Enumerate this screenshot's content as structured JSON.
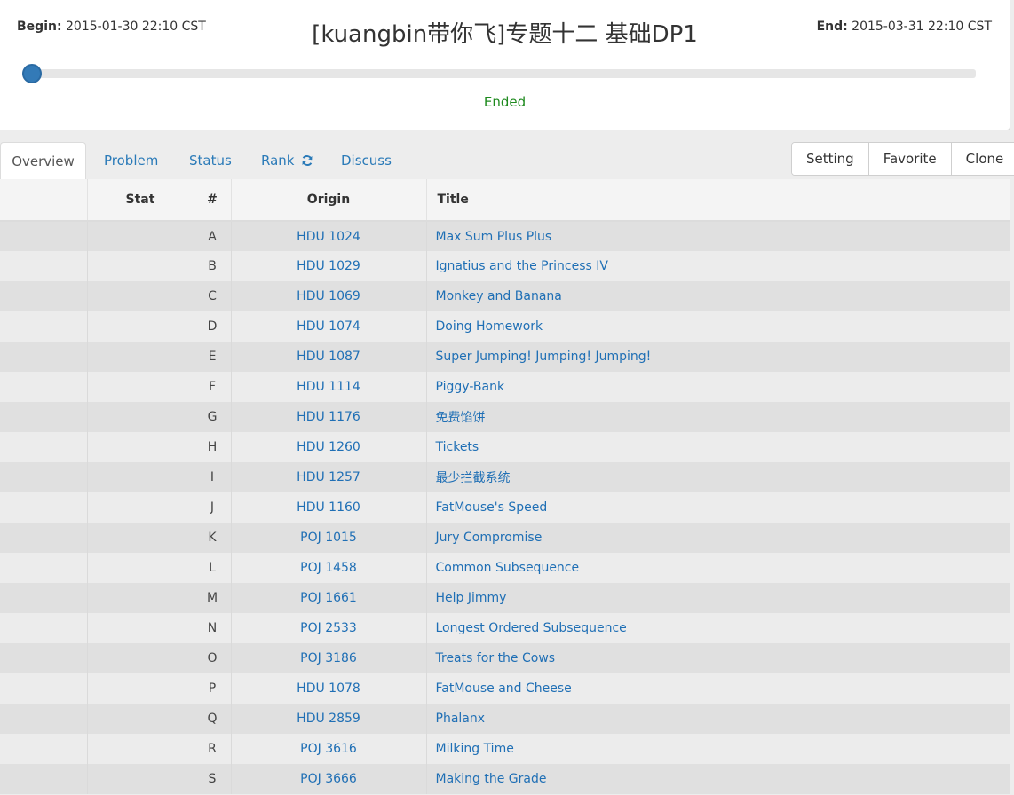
{
  "header": {
    "begin_label": "Begin:",
    "begin_value": "2015-01-30 22:10 CST",
    "end_label": "End:",
    "end_value": "2015-03-31 22:10 CST",
    "title": "[kuangbin带你飞]专题十二 基础DP1",
    "status": "Ended"
  },
  "tabs": {
    "overview": "Overview",
    "problem": "Problem",
    "status": "Status",
    "rank": "Rank",
    "discuss": "Discuss"
  },
  "actions": {
    "setting": "Setting",
    "favorite": "Favorite",
    "clone": "Clone"
  },
  "table": {
    "headers": {
      "stat": "Stat",
      "num": "#",
      "origin": "Origin",
      "title": "Title"
    },
    "rows": [
      {
        "num": "A",
        "origin": "HDU 1024",
        "title": "Max Sum Plus Plus"
      },
      {
        "num": "B",
        "origin": "HDU 1029",
        "title": "Ignatius and the Princess IV"
      },
      {
        "num": "C",
        "origin": "HDU 1069",
        "title": "Monkey and Banana"
      },
      {
        "num": "D",
        "origin": "HDU 1074",
        "title": "Doing Homework"
      },
      {
        "num": "E",
        "origin": "HDU 1087",
        "title": "Super Jumping! Jumping! Jumping!"
      },
      {
        "num": "F",
        "origin": "HDU 1114",
        "title": "Piggy-Bank"
      },
      {
        "num": "G",
        "origin": "HDU 1176",
        "title": "免费馅饼"
      },
      {
        "num": "H",
        "origin": "HDU 1260",
        "title": "Tickets"
      },
      {
        "num": "I",
        "origin": "HDU 1257",
        "title": "最少拦截系统"
      },
      {
        "num": "J",
        "origin": "HDU 1160",
        "title": "FatMouse's Speed"
      },
      {
        "num": "K",
        "origin": "POJ 1015",
        "title": "Jury Compromise"
      },
      {
        "num": "L",
        "origin": "POJ 1458",
        "title": "Common Subsequence"
      },
      {
        "num": "M",
        "origin": "POJ 1661",
        "title": "Help Jimmy"
      },
      {
        "num": "N",
        "origin": "POJ 2533",
        "title": "Longest Ordered Subsequence"
      },
      {
        "num": "O",
        "origin": "POJ 3186",
        "title": "Treats for the Cows"
      },
      {
        "num": "P",
        "origin": "HDU 1078",
        "title": "FatMouse and Cheese"
      },
      {
        "num": "Q",
        "origin": "HDU 2859",
        "title": "Phalanx"
      },
      {
        "num": "R",
        "origin": "POJ 3616",
        "title": "Milking Time"
      },
      {
        "num": "S",
        "origin": "POJ 3666",
        "title": "Making the Grade"
      }
    ]
  }
}
